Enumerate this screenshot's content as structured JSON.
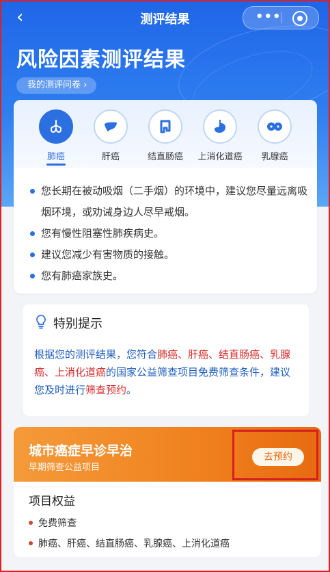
{
  "nav": {
    "back_icon": "‹",
    "title": "测评结果"
  },
  "header": {
    "title": "风险因素测评结果",
    "questionnaire_label": "我的测评问卷 ›"
  },
  "tabs": [
    {
      "label": "肺癌",
      "icon": "lung-icon",
      "active": true
    },
    {
      "label": "肝癌",
      "icon": "liver-icon",
      "active": false
    },
    {
      "label": "结直肠癌",
      "icon": "intestine-icon",
      "active": false
    },
    {
      "label": "上消化道癌",
      "icon": "stomach-icon",
      "active": false
    },
    {
      "label": "乳腺癌",
      "icon": "breast-icon",
      "active": false
    }
  ],
  "advice": [
    "您长期在被动吸烟（二手烟）的环境中，建议您尽量远离吸烟环境，或劝诫身边人尽早戒烟。",
    "您有慢性阻塞性肺疾病史。",
    "建议您减少有害物质的接触。",
    "您有肺癌家族史。"
  ],
  "tips": {
    "title": "特别提示",
    "p1": "根据您的测评结果，您符合",
    "h1": "肺癌、肝癌、结直肠癌、乳腺癌、上消化道癌",
    "p2": "的国家公益筛查项目免费筛查条件，建议您及时进行",
    "h2": "筛查预约",
    "p3": "。"
  },
  "promo": {
    "title": "城市癌症早诊早治",
    "subtitle": "早期筛查公益项目",
    "book_label": "去预约",
    "benefits_title": "项目权益",
    "benefits": [
      "免费筛查",
      "肺癌、肝癌、结直肠癌、乳腺癌、上消化道癌"
    ]
  },
  "colors": {
    "primary": "#2b6fe0",
    "accent_orange": "#f0811e",
    "highlight_red": "#d42b2b"
  }
}
